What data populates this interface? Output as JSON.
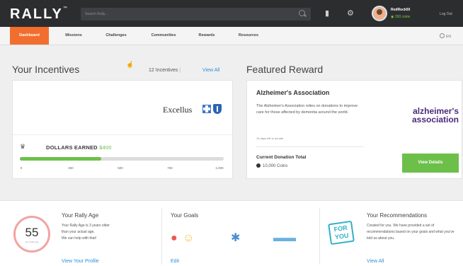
{
  "header": {
    "logo": "RALLY",
    "search_placeholder": "Search Rally...",
    "username": "RedRock00",
    "coins": "150 coins",
    "logout": "Log Out"
  },
  "nav": {
    "items": [
      "Dashboard",
      "Missions",
      "Challenges",
      "Communities",
      "Rewards",
      "Resources"
    ],
    "active": "Dashboard",
    "language": "EN"
  },
  "incentives": {
    "heading": "Your Incentives",
    "count": "12 Incentives",
    "separator": "|",
    "view_all": "View All",
    "sponsor": "Excellus",
    "dollars_label": "DOLLARS EARNED",
    "dollars_value": "$400",
    "progress_fraction": 0.4,
    "ticks": [
      "0",
      "250",
      "500",
      "750",
      "1,000"
    ]
  },
  "featured": {
    "heading": "Featured Reward",
    "title": "Alzheimer's Association",
    "description": "The Alzheimer's Association relies on donations to improve care for those affected by dementia around the world.",
    "days_left": "15 days left to donate",
    "total_label": "Current Donation Total",
    "total_value": "10,000 Coins",
    "logo_line1": "alzheimer's",
    "logo_line2": "association",
    "button": "View Details"
  },
  "rally_age": {
    "heading": "Your Rally Age",
    "age": "55",
    "age_caption": "Your Rally Age",
    "text1": "Your Rally Age is 3 years older",
    "text2": "than your actual age.",
    "text3": "We can help with that!",
    "link": "View Your Profile"
  },
  "goals": {
    "heading": "Your Goals",
    "link": "Edit"
  },
  "recommendations": {
    "heading": "Your Recommendations",
    "badge_line1": "FOR",
    "badge_line2": "YOU",
    "text": "Created for you. We have provided a set of recommendations based on your goals and what you've told us about you.",
    "link": "View All"
  },
  "colors": {
    "accent": "#f26e2e",
    "green": "#6cc04a",
    "link": "#2f8fd8",
    "header_bg": "#2c2d2f",
    "alz_purple": "#4b2a7a"
  }
}
